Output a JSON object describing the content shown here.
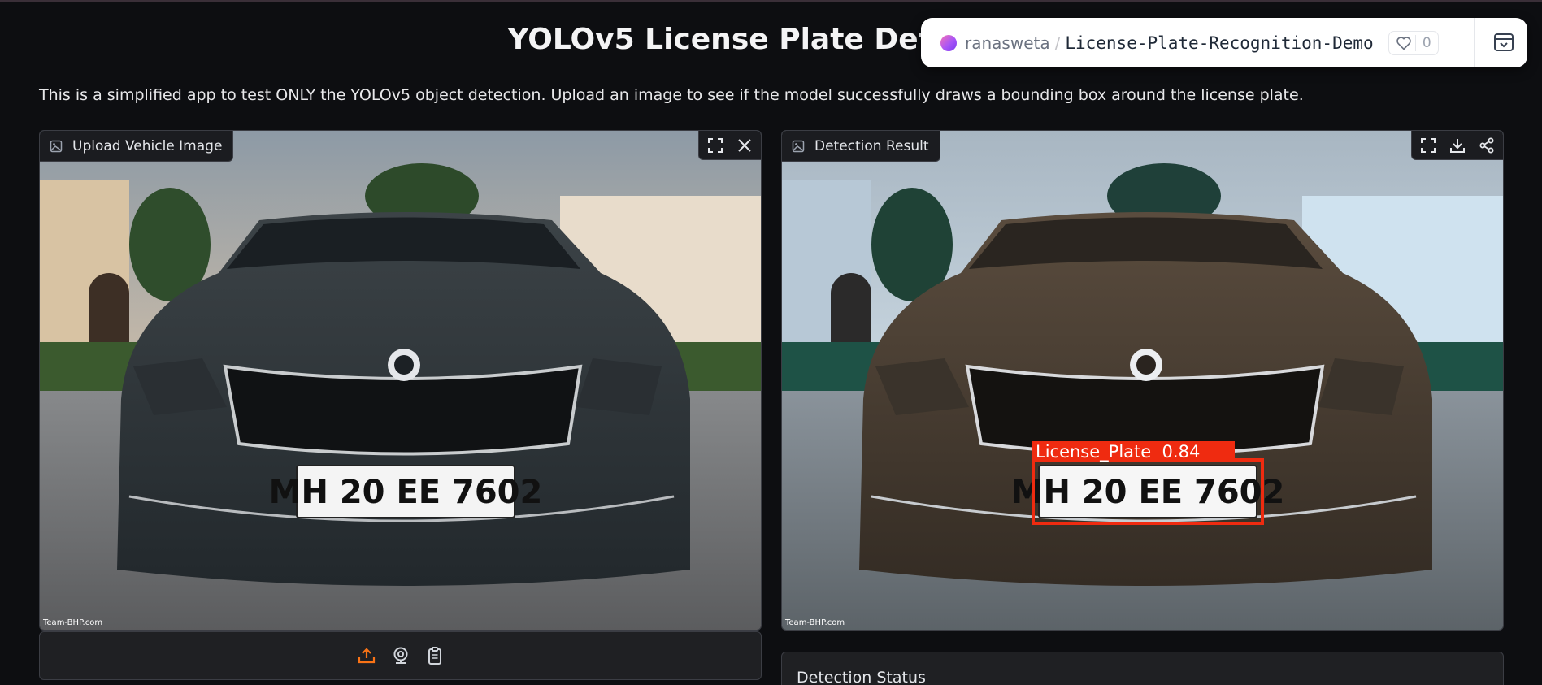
{
  "page": {
    "title": "YOLOv5 License Plate Detection",
    "description": "This is a simplified app to test ONLY the YOLOv5 object detection. Upload an image to see if the model successfully draws a bounding box around the license plate."
  },
  "space_badge": {
    "owner": "ranasweta",
    "separator": "/",
    "name": "License-Plate-Recognition-Demo",
    "likes": "0"
  },
  "input_panel": {
    "label": "Upload Vehicle Image",
    "plate_text": "MH 20 EE 7602",
    "watermark": "Team-BHP.com"
  },
  "output_panel": {
    "label": "Detection Result",
    "plate_text": "MH 20 EE 7602",
    "detection_label": "License_Plate  0.84",
    "watermark": "Team-BHP.com"
  },
  "status_panel": {
    "label": "Detection Status"
  },
  "colors": {
    "background": "#0d0e11",
    "panel": "#1f2023",
    "accent_orange": "#f97316",
    "box_red": "#ef2b10"
  },
  "icons": {
    "fullscreen": "fullscreen-icon",
    "close": "close-icon",
    "download": "download-icon",
    "share": "share-icon",
    "upload": "upload-icon",
    "webcam": "webcam-icon",
    "clipboard": "clipboard-icon",
    "image": "image-icon",
    "heart": "heart-icon",
    "menu": "space-menu-icon"
  }
}
